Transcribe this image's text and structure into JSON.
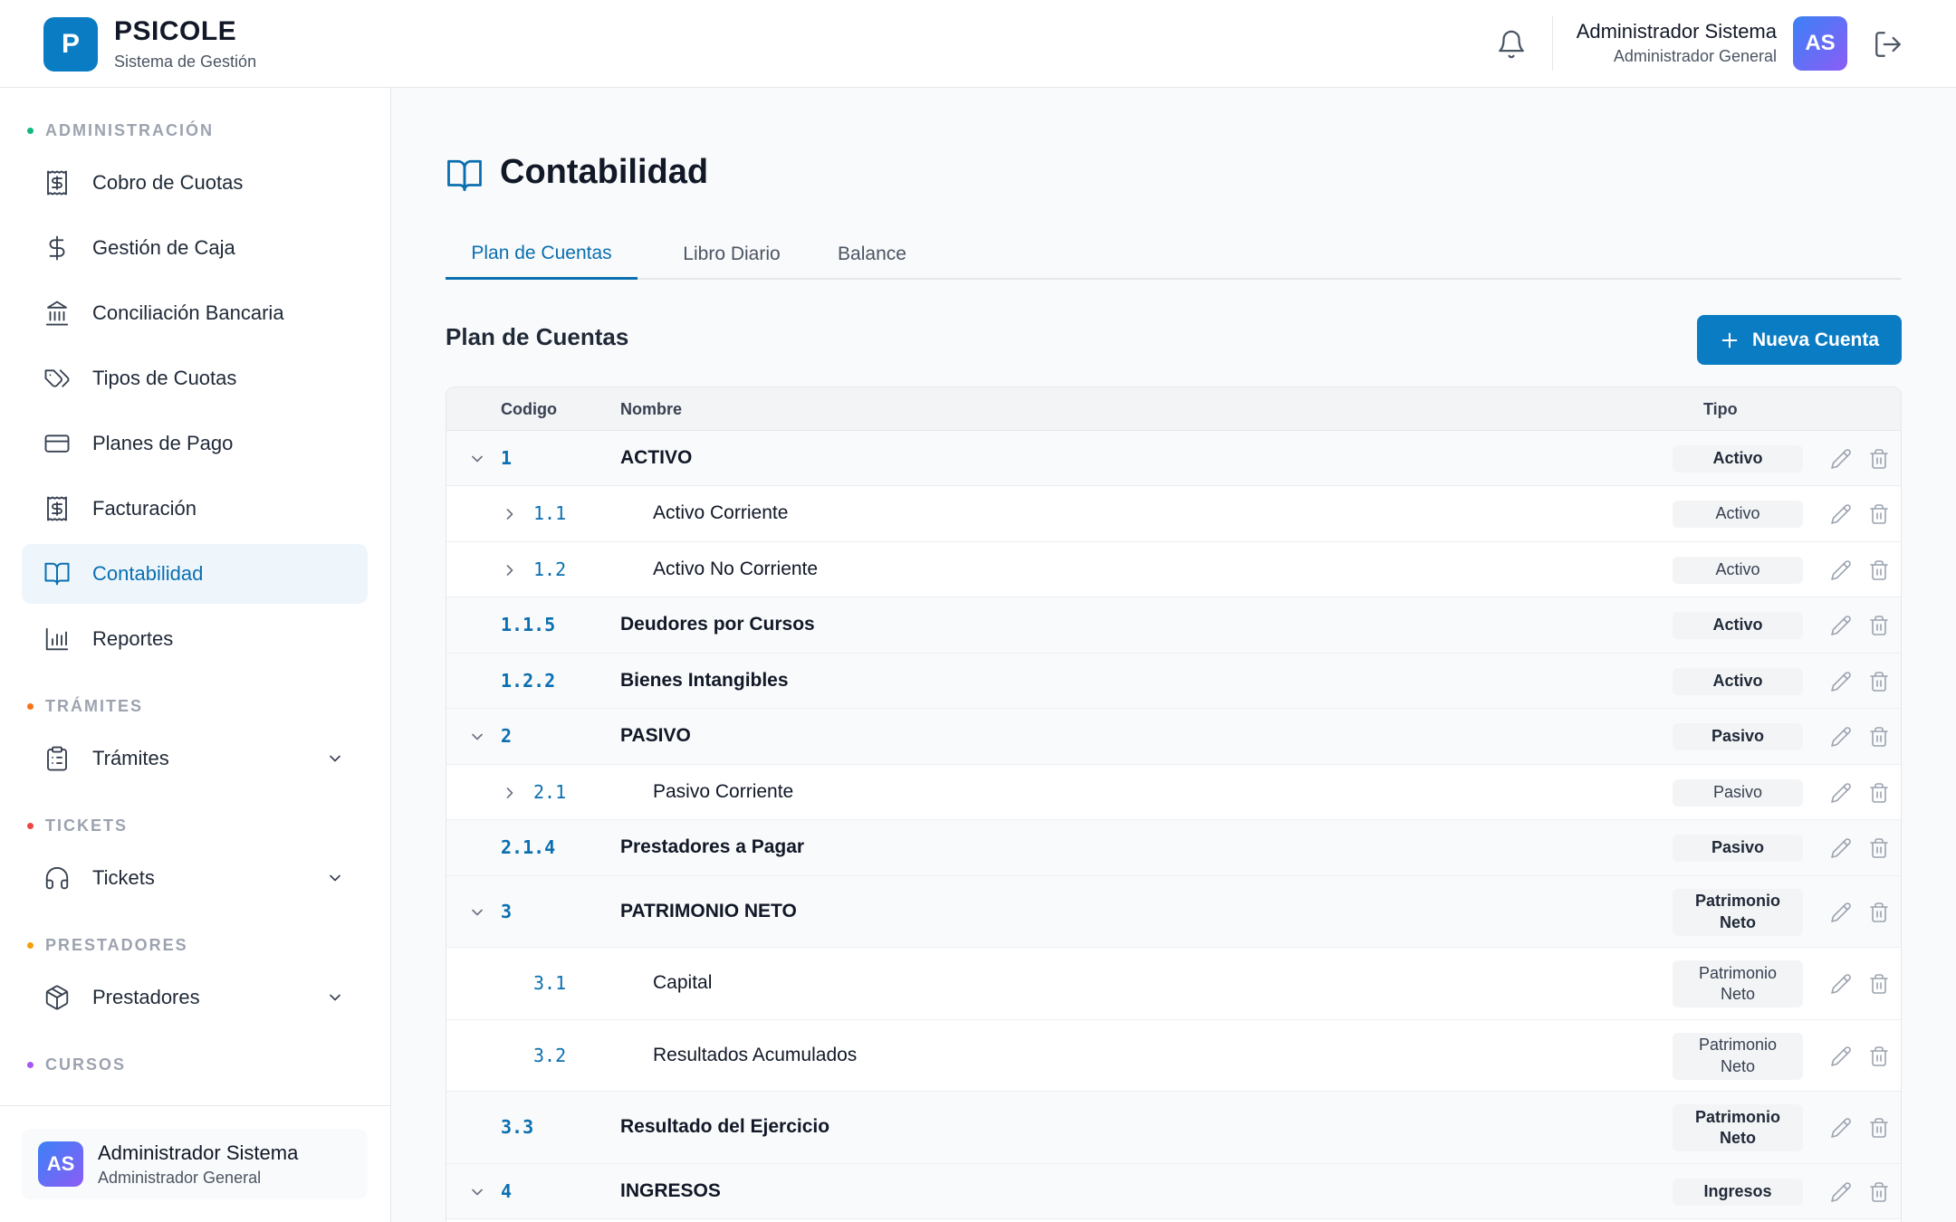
{
  "app": {
    "logo_letter": "P",
    "name": "PSICOLE",
    "subtitle": "Sistema de Gestión"
  },
  "header": {
    "user_name": "Administrador Sistema",
    "user_role": "Administrador General",
    "avatar_initials": "AS"
  },
  "sidebar": {
    "sections": [
      {
        "label": "ADMINISTRACIÓN",
        "color": "#10b981"
      },
      {
        "label": "TRÁMITES",
        "color": "#f97316"
      },
      {
        "label": "TICKETS",
        "color": "#ef4444"
      },
      {
        "label": "PRESTADORES",
        "color": "#f59e0b"
      },
      {
        "label": "CURSOS",
        "color": "#a855f7"
      }
    ],
    "items": [
      {
        "label": "Cobro de Cuotas",
        "icon": "receipt-dollar-icon"
      },
      {
        "label": "Gestión de Caja",
        "icon": "dollar-icon"
      },
      {
        "label": "Conciliación Bancaria",
        "icon": "bank-icon"
      },
      {
        "label": "Tipos de Cuotas",
        "icon": "tags-icon"
      },
      {
        "label": "Planes de Pago",
        "icon": "credit-card-icon"
      },
      {
        "label": "Facturación",
        "icon": "receipt-dollar-icon"
      },
      {
        "label": "Contabilidad",
        "icon": "book-open-icon",
        "active": true
      },
      {
        "label": "Reportes",
        "icon": "bar-chart-icon"
      },
      {
        "label": "Trámites",
        "icon": "clipboard-icon"
      },
      {
        "label": "Tickets",
        "icon": "headphones-icon"
      },
      {
        "label": "Prestadores",
        "icon": "package-icon"
      }
    ],
    "footer_user": {
      "initials": "AS",
      "name": "Administrador Sistema",
      "role": "Administrador General"
    }
  },
  "main": {
    "page_title": "Contabilidad",
    "tabs": [
      {
        "label": "Plan de Cuentas",
        "active": true
      },
      {
        "label": "Libro Diario",
        "active": false
      },
      {
        "label": "Balance",
        "active": false
      }
    ],
    "section_title": "Plan de Cuentas",
    "new_button_label": "Nueva Cuenta",
    "table": {
      "columns": [
        "Codigo",
        "Nombre",
        "Tipo"
      ],
      "rows": [
        {
          "code": "1",
          "name": "ACTIVO",
          "type": "Activo",
          "level": 1,
          "expander": "expanded"
        },
        {
          "code": "1.1",
          "name": "Activo Corriente",
          "type": "Activo",
          "level": 2,
          "expander": "collapsed"
        },
        {
          "code": "1.2",
          "name": "Activo No Corriente",
          "type": "Activo",
          "level": 2,
          "expander": "collapsed"
        },
        {
          "code": "1.1.5",
          "name": "Deudores por Cursos",
          "type": "Activo",
          "level": 1,
          "expander": "none"
        },
        {
          "code": "1.2.2",
          "name": "Bienes Intangibles",
          "type": "Activo",
          "level": 1,
          "expander": "none"
        },
        {
          "code": "2",
          "name": "PASIVO",
          "type": "Pasivo",
          "level": 1,
          "expander": "expanded"
        },
        {
          "code": "2.1",
          "name": "Pasivo Corriente",
          "type": "Pasivo",
          "level": 2,
          "expander": "collapsed"
        },
        {
          "code": "2.1.4",
          "name": "Prestadores a Pagar",
          "type": "Pasivo",
          "level": 1,
          "expander": "none"
        },
        {
          "code": "3",
          "name": "PATRIMONIO NETO",
          "type": "Patrimonio Neto",
          "level": 1,
          "expander": "expanded"
        },
        {
          "code": "3.1",
          "name": "Capital",
          "type": "Patrimonio Neto",
          "level": 2,
          "expander": "none"
        },
        {
          "code": "3.2",
          "name": "Resultados Acumulados",
          "type": "Patrimonio Neto",
          "level": 2,
          "expander": "none"
        },
        {
          "code": "3.3",
          "name": "Resultado del Ejercicio",
          "type": "Patrimonio Neto",
          "level": 1,
          "expander": "none"
        },
        {
          "code": "4",
          "name": "INGRESOS",
          "type": "Ingresos",
          "level": 1,
          "expander": "expanded"
        }
      ]
    }
  }
}
